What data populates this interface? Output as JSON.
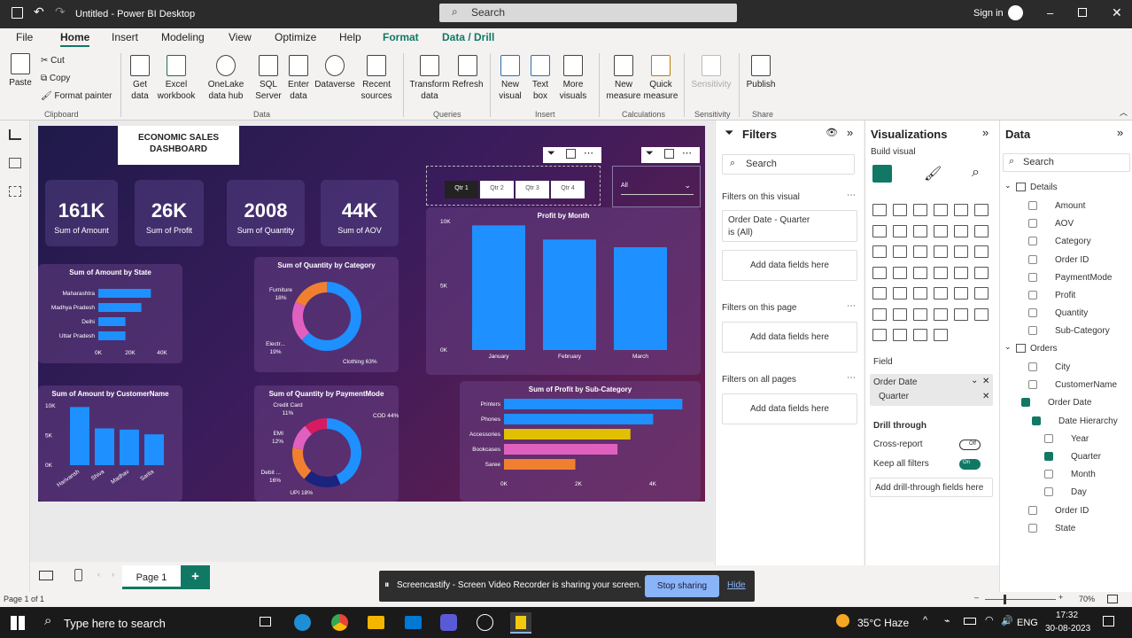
{
  "titlebar": {
    "title": "Untitled - Power BI Desktop",
    "search": "Search",
    "signin": "Sign in"
  },
  "menu": {
    "file": "File",
    "home": "Home",
    "insert": "Insert",
    "modeling": "Modeling",
    "view": "View",
    "optimize": "Optimize",
    "help": "Help",
    "format": "Format",
    "datadrill": "Data / Drill"
  },
  "ribbon": {
    "paste": "Paste",
    "cut": "Cut",
    "copy": "Copy",
    "format_painter": "Format painter",
    "clipboard": "Clipboard",
    "get_data": "Get data",
    "excel": "Excel workbook",
    "onelake": "OneLake data hub",
    "sql": "SQL Server",
    "enter_data": "Enter data",
    "dataverse": "Dataverse",
    "recent": "Recent sources",
    "data_group": "Data",
    "transform": "Transform data",
    "refresh": "Refresh",
    "queries": "Queries",
    "new_visual": "New visual",
    "text_box": "Text box",
    "more_visuals": "More visuals",
    "insert_group": "Insert",
    "new_measure": "New measure",
    "quick_measure": "Quick measure",
    "calculations": "Calculations",
    "sensitivity": "Sensitivity",
    "sensitivity_group": "Sensitivity",
    "publish": "Publish",
    "share": "Share"
  },
  "dashboard": {
    "title": "ECONOMIC SALES DASHBOARD",
    "kpis": [
      {
        "value": "161K",
        "label": "Sum of Amount"
      },
      {
        "value": "26K",
        "label": "Sum of Profit"
      },
      {
        "value": "2008",
        "label": "Sum of Quantity"
      },
      {
        "value": "44K",
        "label": "Sum of AOV"
      }
    ],
    "slicer": [
      "Qtr 1",
      "Qtr 2",
      "Qtr 3",
      "Qtr 4"
    ],
    "dropdown": "All"
  },
  "chart_data": [
    {
      "type": "bar",
      "title": "Sum of Amount by State",
      "categories": [
        "Maharashtra",
        "Madhya Pradesh",
        "Delhi",
        "Uttar Pradesh"
      ],
      "values": [
        33000,
        27000,
        17000,
        17000
      ],
      "xticks": [
        "0K",
        "20K",
        "40K"
      ],
      "xlim": [
        0,
        40000
      ],
      "orientation": "horizontal"
    },
    {
      "type": "pie",
      "title": "Sum of Quantity by Category",
      "categories": [
        "Clothing",
        "Electronics",
        "Furniture"
      ],
      "values": [
        63,
        19,
        18
      ],
      "labels": [
        "Furniture\n18%",
        "Electr...\n19%",
        "Clothing 63%"
      ]
    },
    {
      "type": "bar",
      "title": "Profit by Month",
      "categories": [
        "January",
        "February",
        "March"
      ],
      "values": [
        9700,
        8600,
        8000
      ],
      "yticks": [
        "0K",
        "5K",
        "10K"
      ],
      "ylim": [
        0,
        10000
      ]
    },
    {
      "type": "bar",
      "title": "Sum of Amount by CustomerName",
      "categories": [
        "Harivansh",
        "Shiva",
        "Madhav",
        "Sarita"
      ],
      "values": [
        9800,
        6200,
        6000,
        5200
      ],
      "yticks": [
        "0K",
        "5K",
        "10K"
      ],
      "ylim": [
        0,
        10000
      ]
    },
    {
      "type": "pie",
      "title": "Sum of Quantity by PaymentMode",
      "categories": [
        "COD",
        "UPI",
        "Debit Card",
        "EMI",
        "Credit Card"
      ],
      "values": [
        44,
        18,
        16,
        12,
        11
      ],
      "labels": [
        "COD 44%",
        "UPI 18%",
        "Debit ...\n16%",
        "EMI\n12%",
        "Credit Card\n11%"
      ]
    },
    {
      "type": "bar",
      "title": "Sum of Profit by Sub-Category",
      "categories": [
        "Printers",
        "Phones",
        "Accessories",
        "Bookcases",
        "Saree"
      ],
      "values": [
        5500,
        4600,
        3900,
        3500,
        2200
      ],
      "xticks": [
        "0K",
        "2K",
        "4K"
      ],
      "xlim": [
        0,
        5600
      ],
      "orientation": "horizontal"
    }
  ],
  "filters": {
    "title": "Filters",
    "search": "Search",
    "on_visual": "Filters on this visual",
    "order_date": "Order Date - Quarter",
    "is_all": "is (All)",
    "add": "Add data fields here",
    "on_page": "Filters on this page",
    "on_all": "Filters on all pages"
  },
  "viz": {
    "title": "Visualizations",
    "build": "Build visual",
    "field": "Field",
    "field_items": [
      "Order Date",
      "Quarter"
    ],
    "drill": "Drill through",
    "cross": "Cross-report",
    "cross_state": "Off",
    "keep": "Keep all filters",
    "keep_state": "On",
    "add_drill": "Add drill-through fields here"
  },
  "data": {
    "title": "Data",
    "search": "Search",
    "tables": [
      {
        "name": "Details",
        "fields": [
          "Amount",
          "AOV",
          "Category",
          "Order ID",
          "PaymentMode",
          "Profit",
          "Quantity",
          "Sub-Category"
        ]
      },
      {
        "name": "Orders",
        "fields": [
          "City",
          "CustomerName",
          "Order Date",
          "Date Hierarchy",
          "Year",
          "Quarter",
          "Month",
          "Day",
          "Order ID",
          "State"
        ]
      }
    ]
  },
  "pages": {
    "page1": "Page 1",
    "add": "+",
    "status": "Page 1 of 1",
    "zoom": "70%"
  },
  "share_bar": {
    "message": "Screencastify - Screen Video Recorder is sharing your screen.",
    "stop": "Stop sharing",
    "hide": "Hide"
  },
  "taskbar": {
    "search": "Type here to search",
    "weather": "35°C Haze",
    "lang": "ENG",
    "time": "17:32",
    "date": "30-08-2023"
  }
}
